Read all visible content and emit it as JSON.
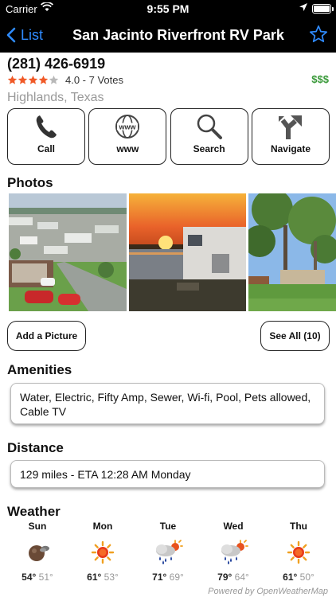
{
  "status_bar": {
    "carrier": "Carrier",
    "time": "9:55 PM"
  },
  "nav": {
    "back_label": "List",
    "title": "San Jacinto Riverfront RV Park"
  },
  "listing": {
    "phone": "(281) 426-6919",
    "rating_stars": 4,
    "rating_text": "4.0 - 7 Votes",
    "price": "$$$",
    "location": "Highlands, Texas"
  },
  "actions": [
    {
      "label": "Call",
      "icon": "phone-icon"
    },
    {
      "label": "www",
      "icon": "globe-icon"
    },
    {
      "label": "Search",
      "icon": "magnifier-icon"
    },
    {
      "label": "Navigate",
      "icon": "fork-arrow-icon"
    }
  ],
  "photos": {
    "title": "Photos",
    "add_label": "Add a Picture",
    "see_all_label": "See All (10)"
  },
  "amenities": {
    "title": "Amenities",
    "text": "Water, Electric, Fifty Amp, Sewer, Wi-fi, Pool, Pets allowed, Cable TV"
  },
  "distance": {
    "title": "Distance",
    "text": "129 miles - ETA 12:28 AM Monday"
  },
  "weather": {
    "title": "Weather",
    "days": [
      {
        "name": "Sun",
        "hi": "54°",
        "lo": "51°",
        "icon": "moon-clouds-icon"
      },
      {
        "name": "Mon",
        "hi": "61°",
        "lo": "53°",
        "icon": "sun-icon"
      },
      {
        "name": "Tue",
        "hi": "71°",
        "lo": "69°",
        "icon": "rain-sun-icon"
      },
      {
        "name": "Wed",
        "hi": "79°",
        "lo": "64°",
        "icon": "rain-sun-icon"
      },
      {
        "name": "Thu",
        "hi": "61°",
        "lo": "50°",
        "icon": "sun-icon"
      }
    ],
    "powered_by": "Powered by OpenWeatherMap"
  },
  "colors": {
    "accent": "#2f8bff",
    "star": "#f05a28",
    "price": "#3a9a3a"
  }
}
